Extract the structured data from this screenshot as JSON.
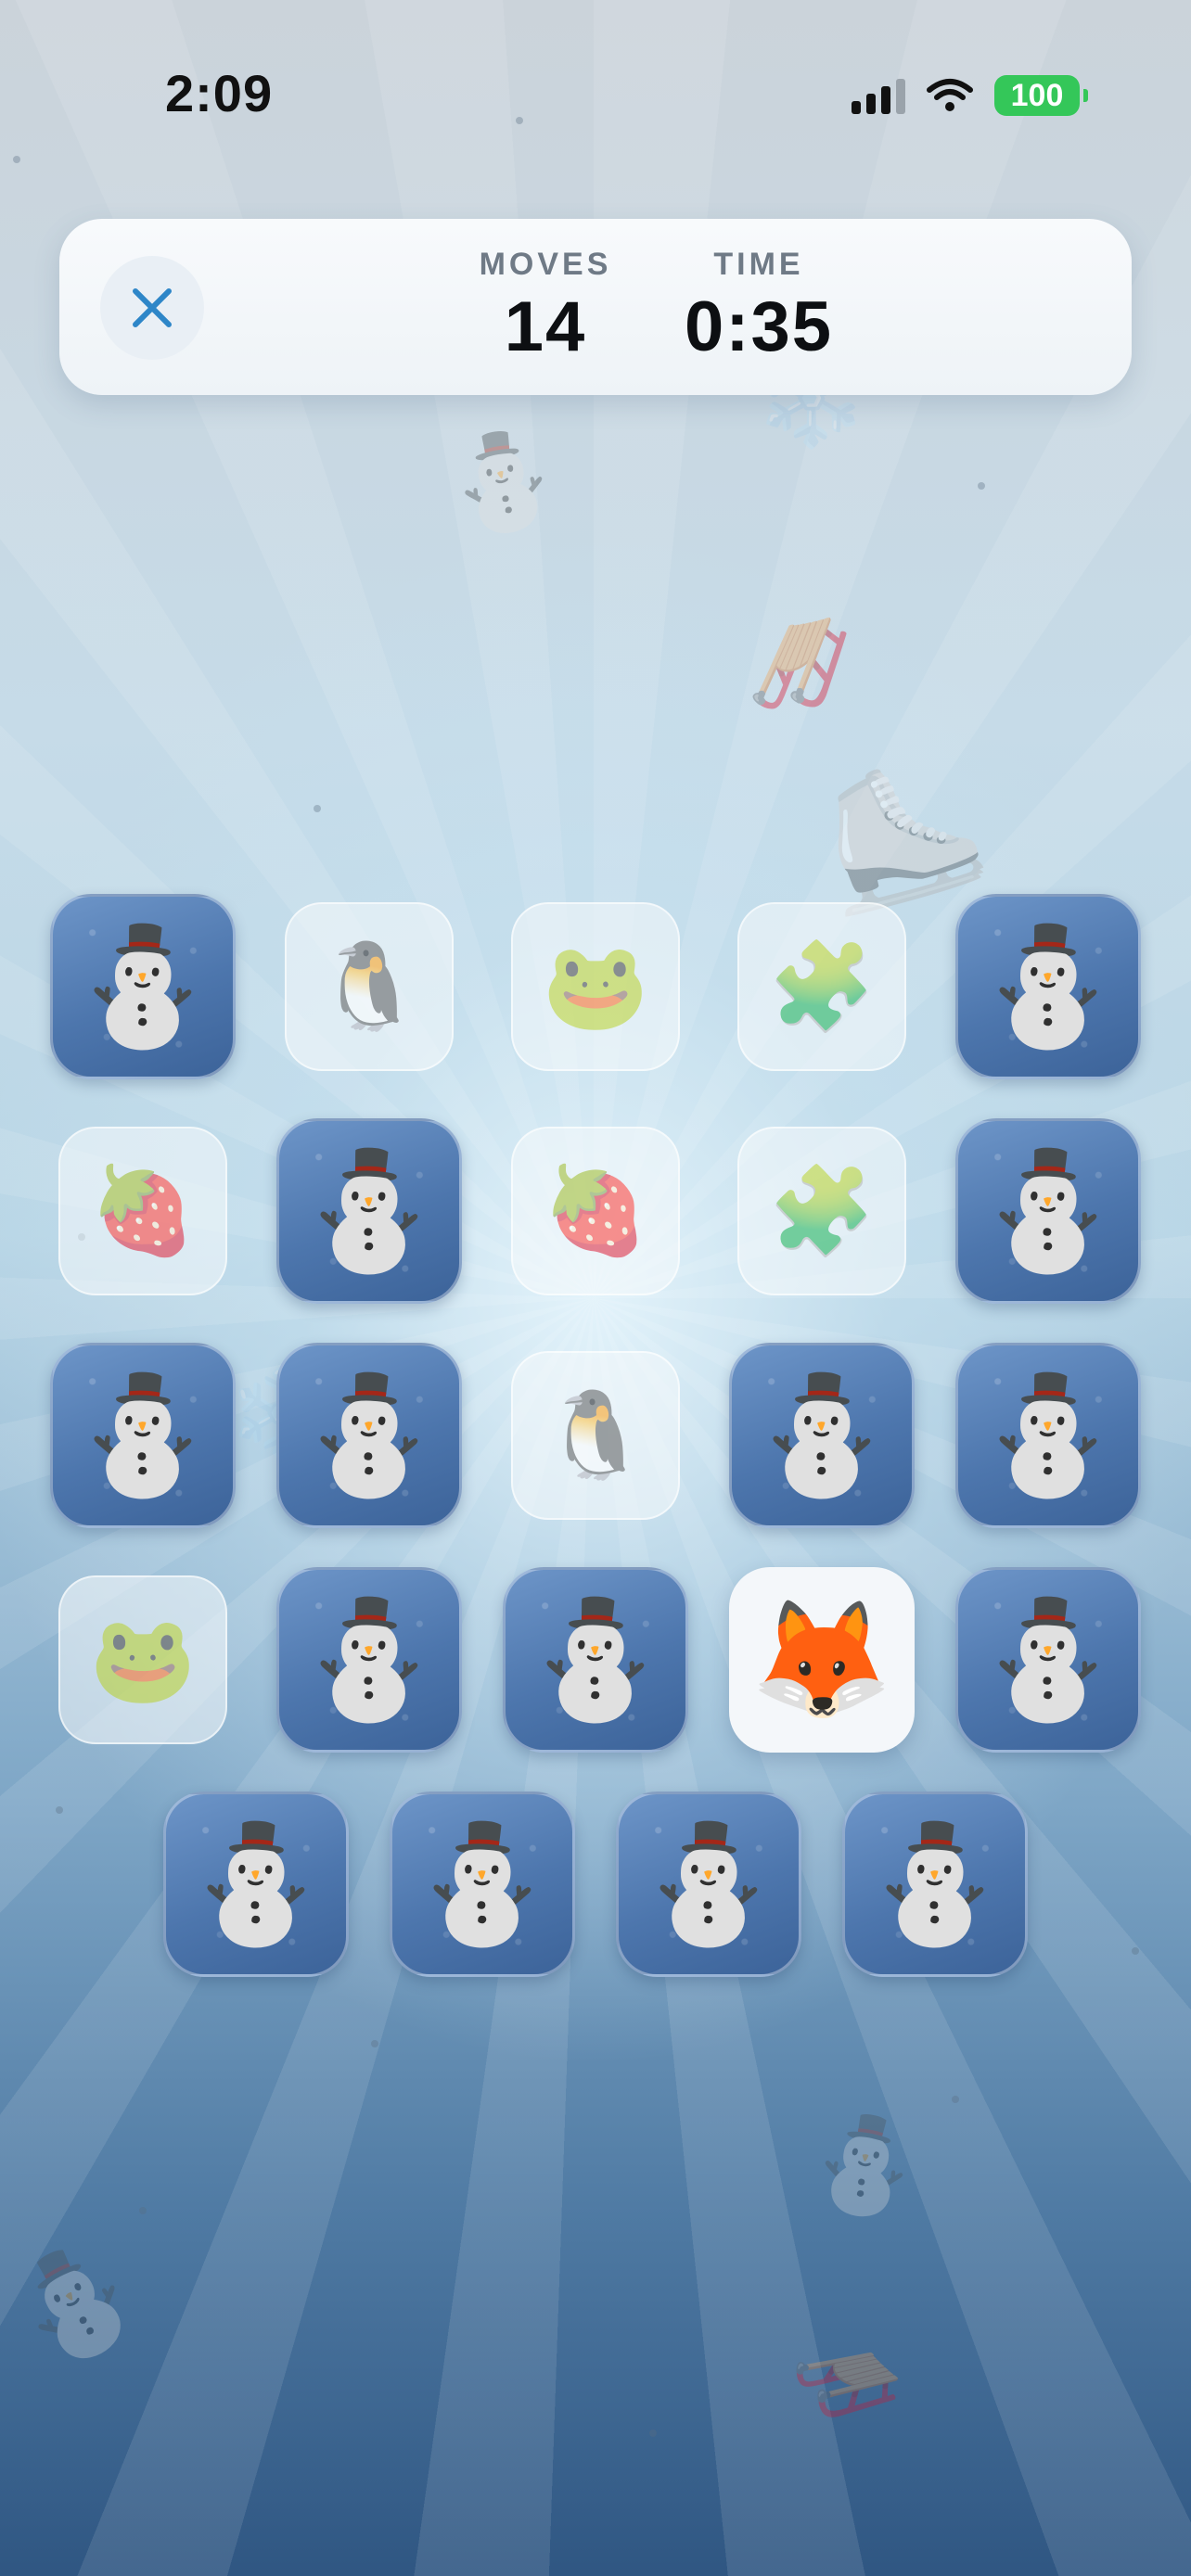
{
  "status_bar": {
    "time": "2:09",
    "battery": "100"
  },
  "hud": {
    "close_icon": "close-icon",
    "moves_label": "MOVES",
    "moves_value": "14",
    "time_label": "TIME",
    "time_value": "0:35"
  },
  "board": {
    "rows": [
      [
        {
          "state": "hidden",
          "symbol": "⛄"
        },
        {
          "state": "matched",
          "symbol": "🐧"
        },
        {
          "state": "matched",
          "symbol": "🐸"
        },
        {
          "state": "matched",
          "symbol": "🧩"
        },
        {
          "state": "hidden",
          "symbol": "⛄"
        }
      ],
      [
        {
          "state": "matched",
          "symbol": "🍓"
        },
        {
          "state": "hidden",
          "symbol": "⛄"
        },
        {
          "state": "matched",
          "symbol": "🍓"
        },
        {
          "state": "matched",
          "symbol": "🧩"
        },
        {
          "state": "hidden",
          "symbol": "⛄"
        }
      ],
      [
        {
          "state": "hidden",
          "symbol": "⛄"
        },
        {
          "state": "hidden",
          "symbol": "⛄"
        },
        {
          "state": "matched",
          "symbol": "🐧"
        },
        {
          "state": "hidden",
          "symbol": "⛄"
        },
        {
          "state": "hidden",
          "symbol": "⛄"
        }
      ],
      [
        {
          "state": "matched",
          "symbol": "🐸"
        },
        {
          "state": "hidden",
          "symbol": "⛄"
        },
        {
          "state": "hidden",
          "symbol": "⛄"
        },
        {
          "state": "revealed",
          "symbol": "🦊"
        },
        {
          "state": "hidden",
          "symbol": "⛄"
        }
      ],
      [
        {
          "state": "hidden",
          "symbol": "⛄"
        },
        {
          "state": "hidden",
          "symbol": "⛄"
        },
        {
          "state": "hidden",
          "symbol": "⛄"
        },
        {
          "state": "hidden",
          "symbol": "⛄"
        }
      ]
    ]
  },
  "background_decorations": [
    "⛄",
    "🛷",
    "⛸️",
    "❄️"
  ]
}
